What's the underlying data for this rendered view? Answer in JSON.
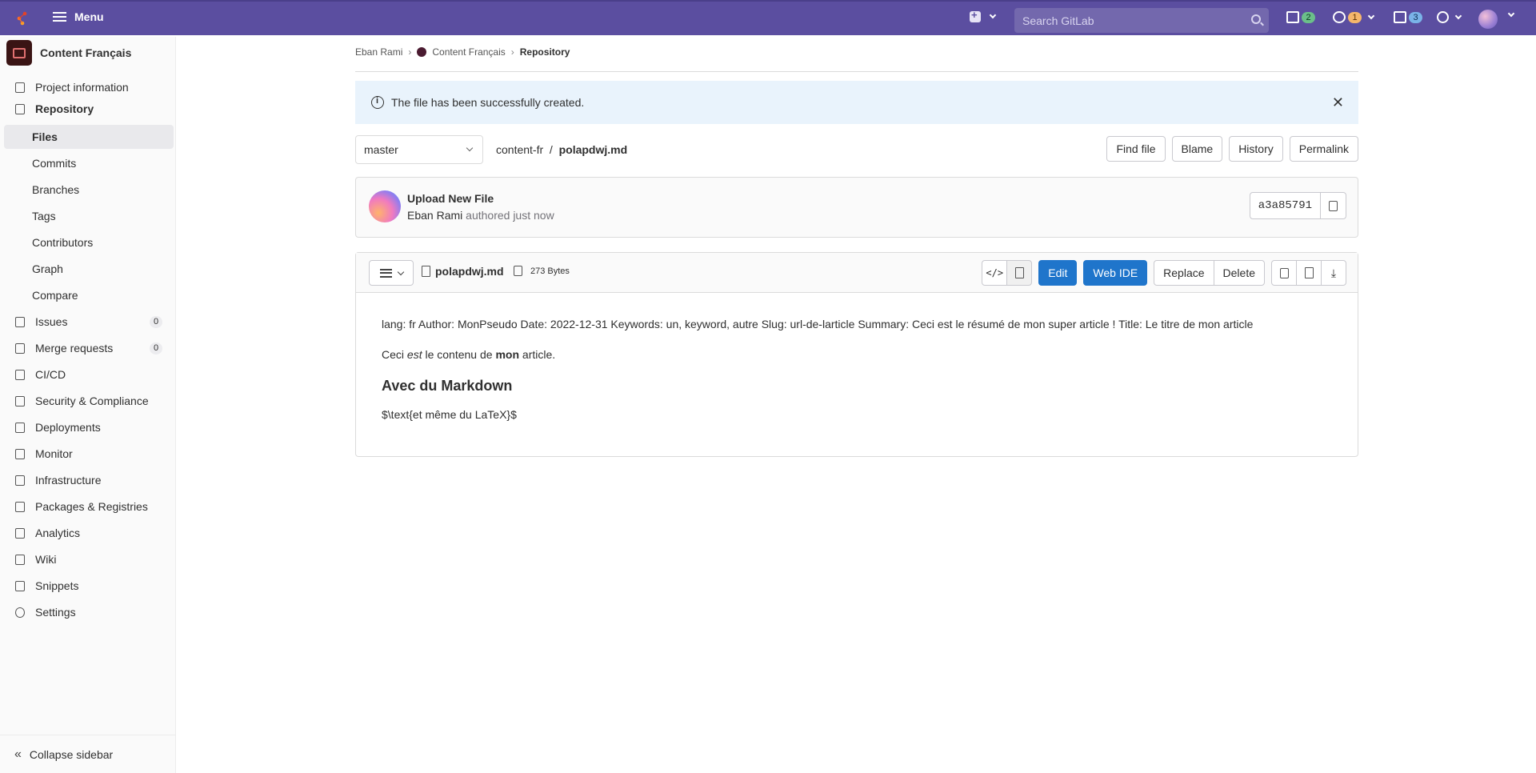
{
  "topbar": {
    "menu_label": "Menu",
    "search_placeholder": "Search GitLab",
    "issues_count": "2",
    "mr_count": "1",
    "todos_count": "3"
  },
  "sidebar": {
    "project_name": "Content Français",
    "items": [
      {
        "label": "Project information",
        "icon": "info-doc-icon"
      },
      {
        "label": "Repository",
        "icon": "repository-icon"
      },
      {
        "label": "Files"
      },
      {
        "label": "Commits"
      },
      {
        "label": "Branches"
      },
      {
        "label": "Tags"
      },
      {
        "label": "Contributors"
      },
      {
        "label": "Graph"
      },
      {
        "label": "Compare"
      },
      {
        "label": "Issues",
        "icon": "issues-icon",
        "count": "0"
      },
      {
        "label": "Merge requests",
        "icon": "merge-request-icon",
        "count": "0"
      },
      {
        "label": "CI/CD",
        "icon": "rocket-icon"
      },
      {
        "label": "Security & Compliance",
        "icon": "shield-icon"
      },
      {
        "label": "Deployments",
        "icon": "deployments-icon"
      },
      {
        "label": "Monitor",
        "icon": "monitor-icon"
      },
      {
        "label": "Infrastructure",
        "icon": "infrastructure-icon"
      },
      {
        "label": "Packages & Registries",
        "icon": "package-icon"
      },
      {
        "label": "Analytics",
        "icon": "chart-icon"
      },
      {
        "label": "Wiki",
        "icon": "book-icon"
      },
      {
        "label": "Snippets",
        "icon": "snippet-icon"
      },
      {
        "label": "Settings",
        "icon": "gear-icon"
      }
    ],
    "collapse_label": "Collapse sidebar"
  },
  "breadcrumb": {
    "user": "Eban Rami",
    "project": "Content Français",
    "current": "Repository"
  },
  "alert": {
    "message": "The file has been successfully created."
  },
  "file_nav": {
    "branch": "master",
    "dir": "content-fr",
    "sep": "/",
    "file": "polapdwj.md",
    "buttons": [
      "Find file",
      "Blame",
      "History",
      "Permalink"
    ]
  },
  "commit": {
    "title": "Upload New File",
    "author": "Eban Rami",
    "when": "authored just now",
    "sha": "a3a85791"
  },
  "file": {
    "name": "polapdwj.md",
    "size": "273 Bytes",
    "edit": "Edit",
    "web_ide": "Web IDE",
    "replace": "Replace",
    "delete": "Delete",
    "meta_line": "lang: fr Author: MonPseudo Date: 2022-12-31 Keywords: un, keyword, autre Slug: url-de-larticle Summary: Ceci est le résumé de mon super article ! Title: Le titre de mon article",
    "p2": {
      "a": "Ceci ",
      "em": "est",
      "b": " le contenu de ",
      "strong": "mon",
      "c": " article."
    },
    "heading": "Avec du Markdown",
    "latex": "$\\text{et même du LaTeX}$"
  },
  "colors": {
    "topbar": "#5b4ea0",
    "primary_button": "#1f75cb",
    "alert_bg": "#e9f3fc"
  }
}
